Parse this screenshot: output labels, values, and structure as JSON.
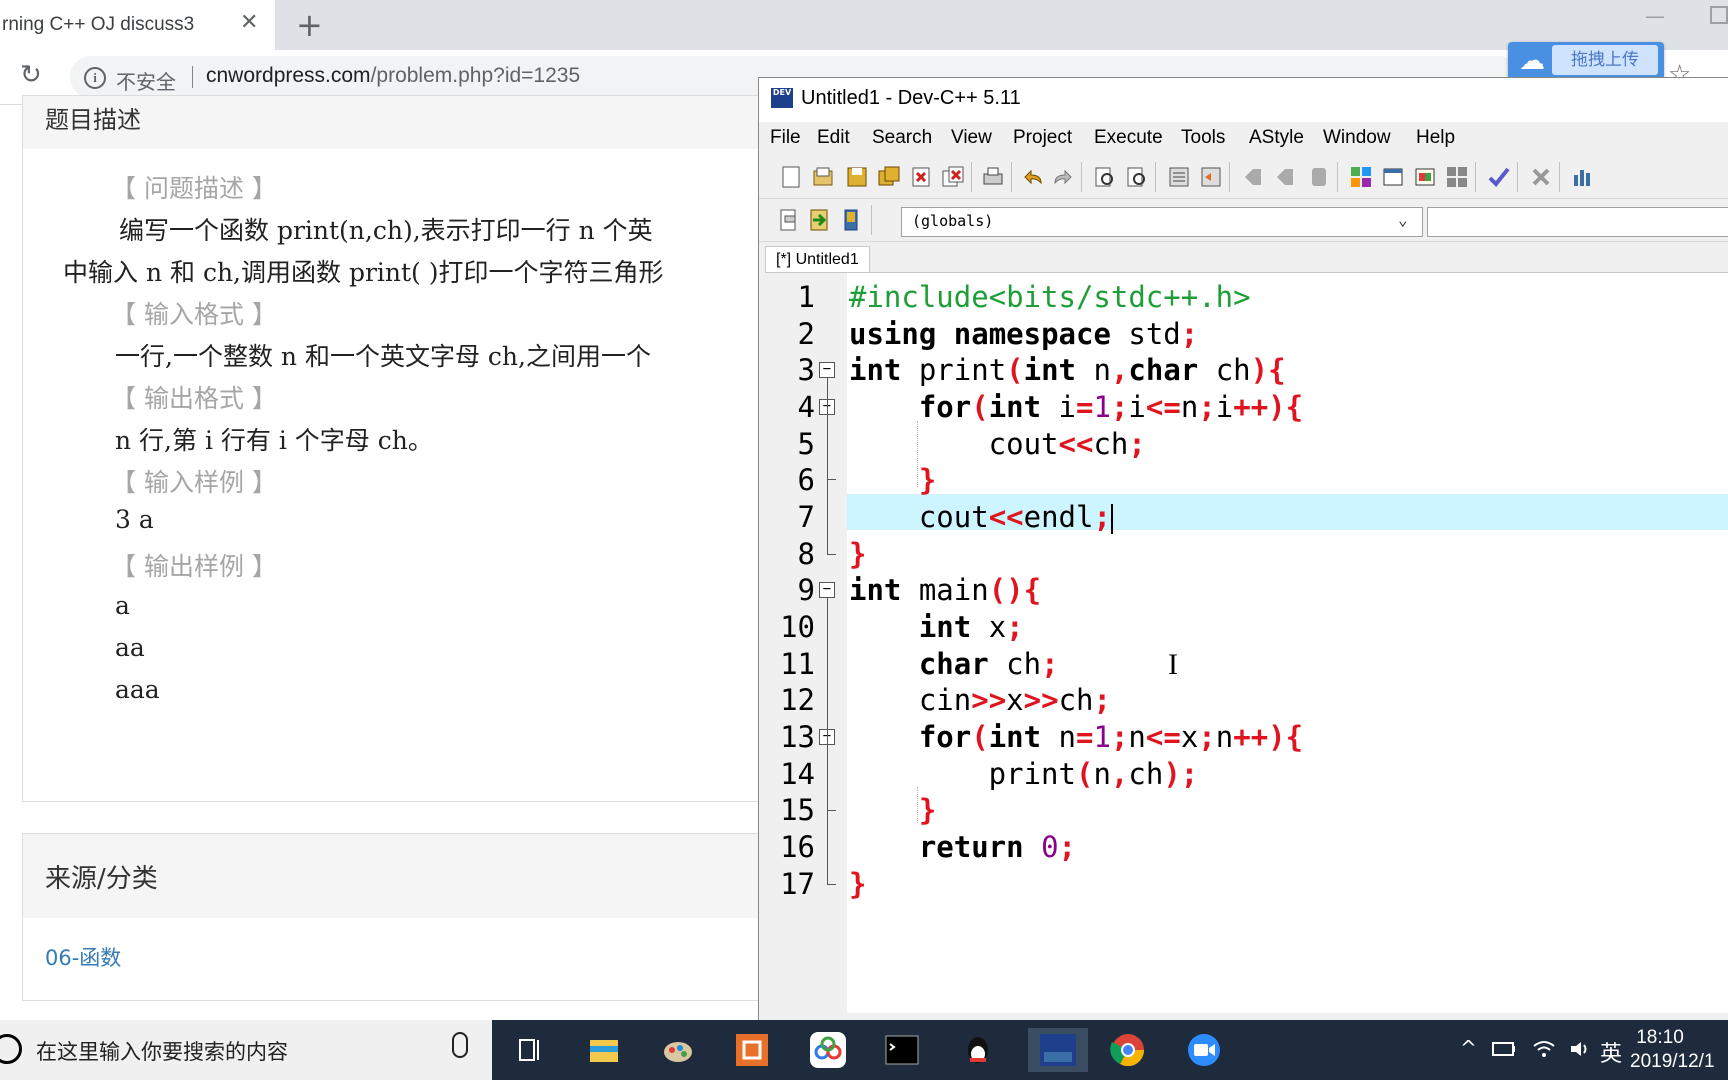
{
  "browser": {
    "tab_title": "rning C++ OJ discuss3",
    "tab_close": "✕",
    "new_tab": "+",
    "security_label": "不安全",
    "url_host": "cnwordpress.com",
    "url_path": "/problem.php?id=1235",
    "baidu_button_label": "拖拽上传"
  },
  "page": {
    "panel1_title": "题目描述",
    "problem": {
      "desc_header": "【 问题描述 】",
      "desc_line1": "编写一个函数 print(n,ch),表示打印一行 n 个英",
      "desc_line2": "中输入 n 和 ch,调用函数 print( )打印一个字符三角形",
      "input_header": "【 输入格式 】",
      "input_text": "一行,一个整数 n 和一个英文字母 ch,之间用一个",
      "output_header": "【 输出格式 】",
      "output_text": "n 行,第 i 行有 i 个字母 ch。",
      "sample_in_header": "【 输入样例 】",
      "sample_in": "3 a",
      "sample_out_header": "【 输出样例 】",
      "sample_out": [
        "a",
        "aa",
        "aaa"
      ]
    },
    "panel2_title": "来源/分类",
    "category_link": "06-函数"
  },
  "devcpp": {
    "title": "Untitled1 - Dev-C++ 5.11",
    "logo_text": "DEV",
    "menu": [
      "File",
      "Edit",
      "Search",
      "View",
      "Project",
      "Execute",
      "Tools",
      "AStyle",
      "Window",
      "Help"
    ],
    "scope_combo": "(globals)",
    "file_tab": "[*] Untitled1",
    "line_numbers": [
      "1",
      "2",
      "3",
      "4",
      "5",
      "6",
      "7",
      "8",
      "9",
      "10",
      "11",
      "12",
      "13",
      "14",
      "15",
      "16",
      "17"
    ],
    "code": [
      "#include<bits/stdc++.h>",
      "using namespace std;",
      "int print(int n,char ch){",
      "    for(int i=1;i<=n;i++){",
      "        cout<<ch;",
      "    }",
      "    cout<<endl;",
      "}",
      "int main(){",
      "    int x;",
      "    char ch;",
      "    cin>>x>>ch;",
      "    for(int n=1;n<=x;n++){",
      "        print(n,ch);",
      "    }",
      "    return 0;",
      "}"
    ],
    "current_line": 7
  },
  "taskbar": {
    "search_placeholder": "在这里输入你要搜索的内容",
    "ime": "英",
    "time": "18:10",
    "date": "2019/12/1"
  },
  "colors": {
    "keyword": "#000000",
    "preprocessor": "#1e9e36",
    "symbol": "#e0141e",
    "number": "#8a008a",
    "current_line": "#cdf5ff",
    "link": "#337ab7"
  }
}
